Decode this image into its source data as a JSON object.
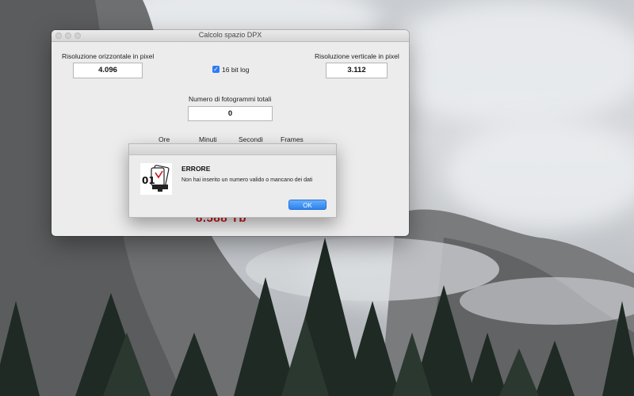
{
  "window": {
    "title": "Calcolo spazio DPX"
  },
  "form": {
    "horizontal_label": "Risoluzione orizzontale in pixel",
    "horizontal_value": "4.096",
    "vertical_label": "Risoluzione verticale in pixel",
    "vertical_value": "3.112",
    "log_checkbox_label": "16 bit log",
    "log_checkbox_checked": true,
    "frames_total_label": "Numero di fotogrammi totali",
    "frames_total_value": "0",
    "time_headers": [
      "Ore",
      "Minuti",
      "Secondi",
      "Frames"
    ],
    "result_text": "8.588 Tb"
  },
  "alert": {
    "title": "ERRORE",
    "message": "Non hai inserito un numero valido o mancano dei dati",
    "ok_label": "OK",
    "icon": "app-icon-01",
    "icon_text": "01"
  },
  "colors": {
    "accent": "#2c7cf6",
    "result": "#c0141a"
  }
}
